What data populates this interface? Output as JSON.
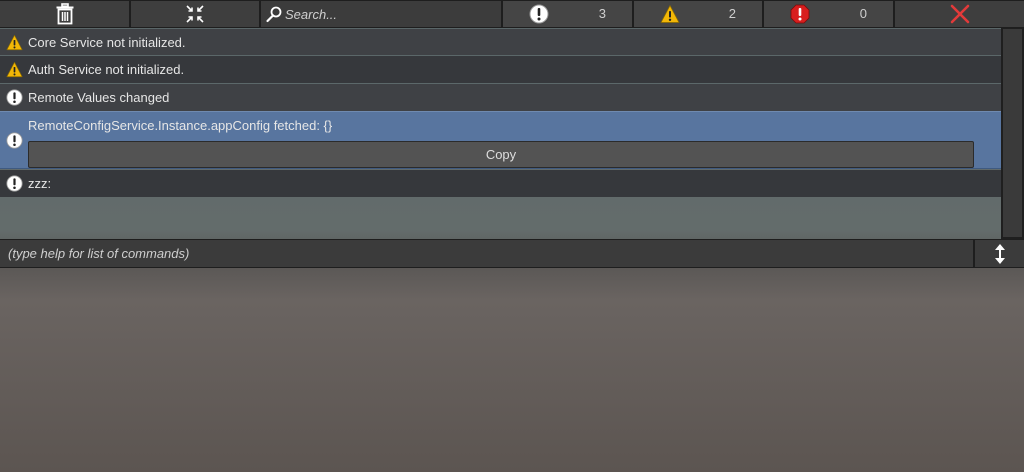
{
  "toolbar": {
    "clear_icon": "trash-icon",
    "collapse_icon": "collapse-arrows-icon",
    "search": {
      "icon": "magnifier-icon",
      "placeholder": "Search..."
    },
    "filters": [
      {
        "type": "info",
        "icon": "info-circle-icon",
        "count": "3"
      },
      {
        "type": "warning",
        "icon": "warning-triangle-icon",
        "count": "2"
      },
      {
        "type": "error",
        "icon": "error-circle-icon",
        "count": "0"
      }
    ],
    "close_icon": "close-x-icon"
  },
  "colors": {
    "info": "#ffffff",
    "warning": "#f2b707",
    "error": "#d81e1e",
    "close": "#e23a3a",
    "selected_row": "#58759f"
  },
  "logs": [
    {
      "type": "warning",
      "message": "Core Service not initialized."
    },
    {
      "type": "warning",
      "message": "Auth Service not initialized."
    },
    {
      "type": "info",
      "message": "Remote Values changed"
    },
    {
      "type": "info",
      "message": "RemoteConfigService.Instance.appConfig fetched: {}",
      "selected": true,
      "action_label": "Copy"
    },
    {
      "type": "info",
      "message": "zzz:"
    }
  ],
  "command": {
    "placeholder": "(type help for list of commands)",
    "resize_icon": "vertical-resize-icon"
  }
}
